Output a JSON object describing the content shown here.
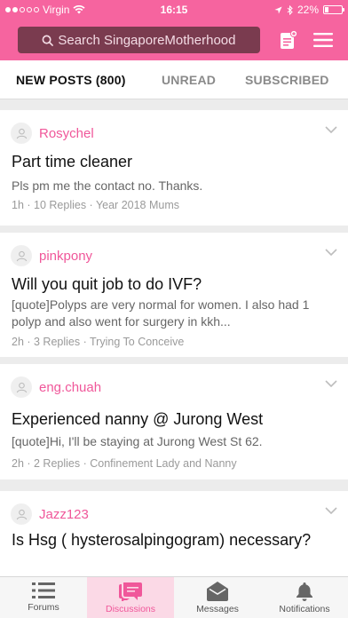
{
  "status_bar": {
    "carrier": "Virgin",
    "time": "16:15",
    "battery": "22%",
    "battery_level": 0.22
  },
  "search": {
    "placeholder": "Search SingaporeMotherhood"
  },
  "tabs": [
    {
      "label": "NEW POSTS (800)",
      "active": true
    },
    {
      "label": "UNREAD",
      "active": false
    },
    {
      "label": "SUBSCRIBED",
      "active": false
    }
  ],
  "posts": [
    {
      "author": "Rosychel",
      "title": "Part time cleaner",
      "excerpt": "Pls pm me the contact no. Thanks.",
      "meta": "1h · 10 Replies · Year 2018 Mums"
    },
    {
      "author": "pinkpony",
      "title": "Will you quit job to do IVF?",
      "excerpt": "[quote]Polyps are very normal for women. I also had 1 polyp and also went for surgery in kkh...",
      "meta": "2h · 3 Replies · Trying To Conceive"
    },
    {
      "author": "eng.chuah",
      "title": "Experienced nanny @ Jurong West",
      "excerpt": "[quote]Hi, I'll be staying at Jurong West St 62.",
      "meta": "2h · 2 Replies · Confinement Lady and Nanny"
    },
    {
      "author": "Jazz123",
      "title": "Is Hsg ( hysterosalpingogram) necessary?",
      "excerpt": "",
      "meta": ""
    }
  ],
  "bottom_nav": [
    {
      "label": "Forums",
      "icon": "list-icon",
      "active": false
    },
    {
      "label": "Discussions",
      "icon": "chat-icon",
      "active": true
    },
    {
      "label": "Messages",
      "icon": "envelope-icon",
      "active": false
    },
    {
      "label": "Notifications",
      "icon": "bell-icon",
      "active": false
    }
  ],
  "colors": {
    "brand_pink": "#f6649f",
    "author_pink": "#f0579a",
    "search_bg": "#7a3b4f"
  }
}
